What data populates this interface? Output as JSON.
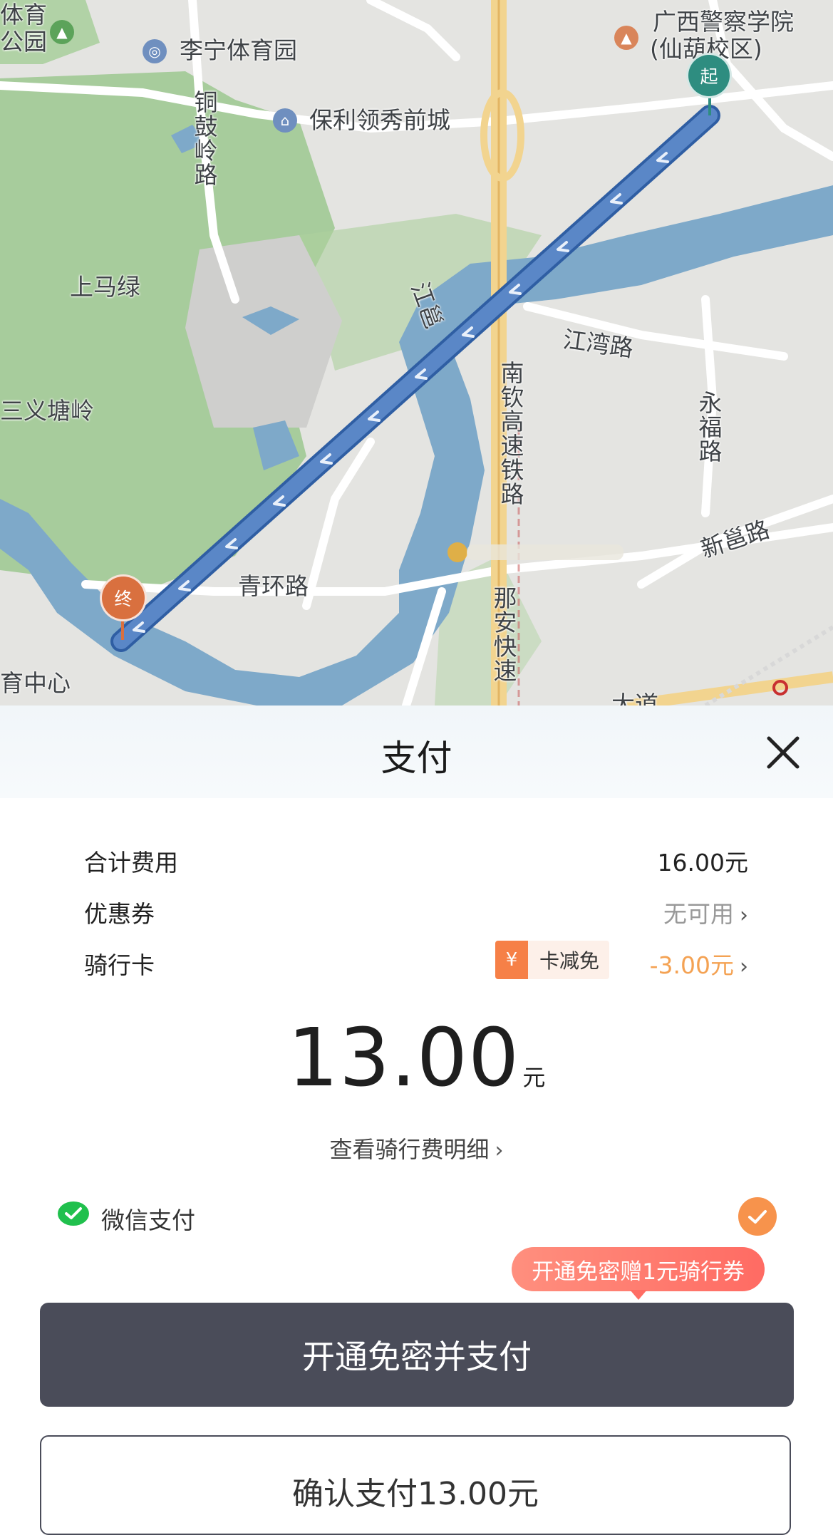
{
  "map": {
    "labels": {
      "top_left_fragment": "体育",
      "top_left_fragment2": "公园",
      "li_ning": "李宁体育园",
      "baoli": "保利领秀前城",
      "guangxi_police": "广西警察学院",
      "xianhu_campus": "(仙葫校区)",
      "tonggu_road": "铜鼓岭路",
      "shangmalu": "上马绿",
      "jiangyong": "江邕",
      "jiangwan_road": "江湾路",
      "yongfu_road": "永福路",
      "nanqin_railway": "南钦高速铁路",
      "sanyitangling": "三义塘岭",
      "xinyong_road": "新邕路",
      "qinghuan_road": "青环路",
      "naan_expressway": "那安快速",
      "tiyu_center": "育中心",
      "dadao": "大道"
    },
    "start_marker": "起",
    "end_marker": "终",
    "colors": {
      "route": "#3d6fb6",
      "start": "#2e8d80",
      "end": "#d9703f",
      "river": "#7aa9cc",
      "green": "#9fc796"
    }
  },
  "sheet": {
    "title": "支付",
    "close_icon": "close-icon",
    "total_label": "合计费用",
    "total_value": "16.00元",
    "coupon_label": "优惠券",
    "coupon_value": "无可用",
    "card_label": "骑行卡",
    "card_tag_icon": "¥",
    "card_tag_text": "卡减免",
    "card_discount": "-3.00元",
    "amount": "13.00",
    "amount_unit": "元",
    "detail_link": "查看骑行费明细",
    "payment_method": "微信支付",
    "promo_bubble": "开通免密赠1元骑行券",
    "primary_button": "开通免密并支付",
    "secondary_button": "确认支付13.00元",
    "chevron": "›",
    "accent_color": "#f7934c",
    "button_color": "#4a4c59"
  }
}
